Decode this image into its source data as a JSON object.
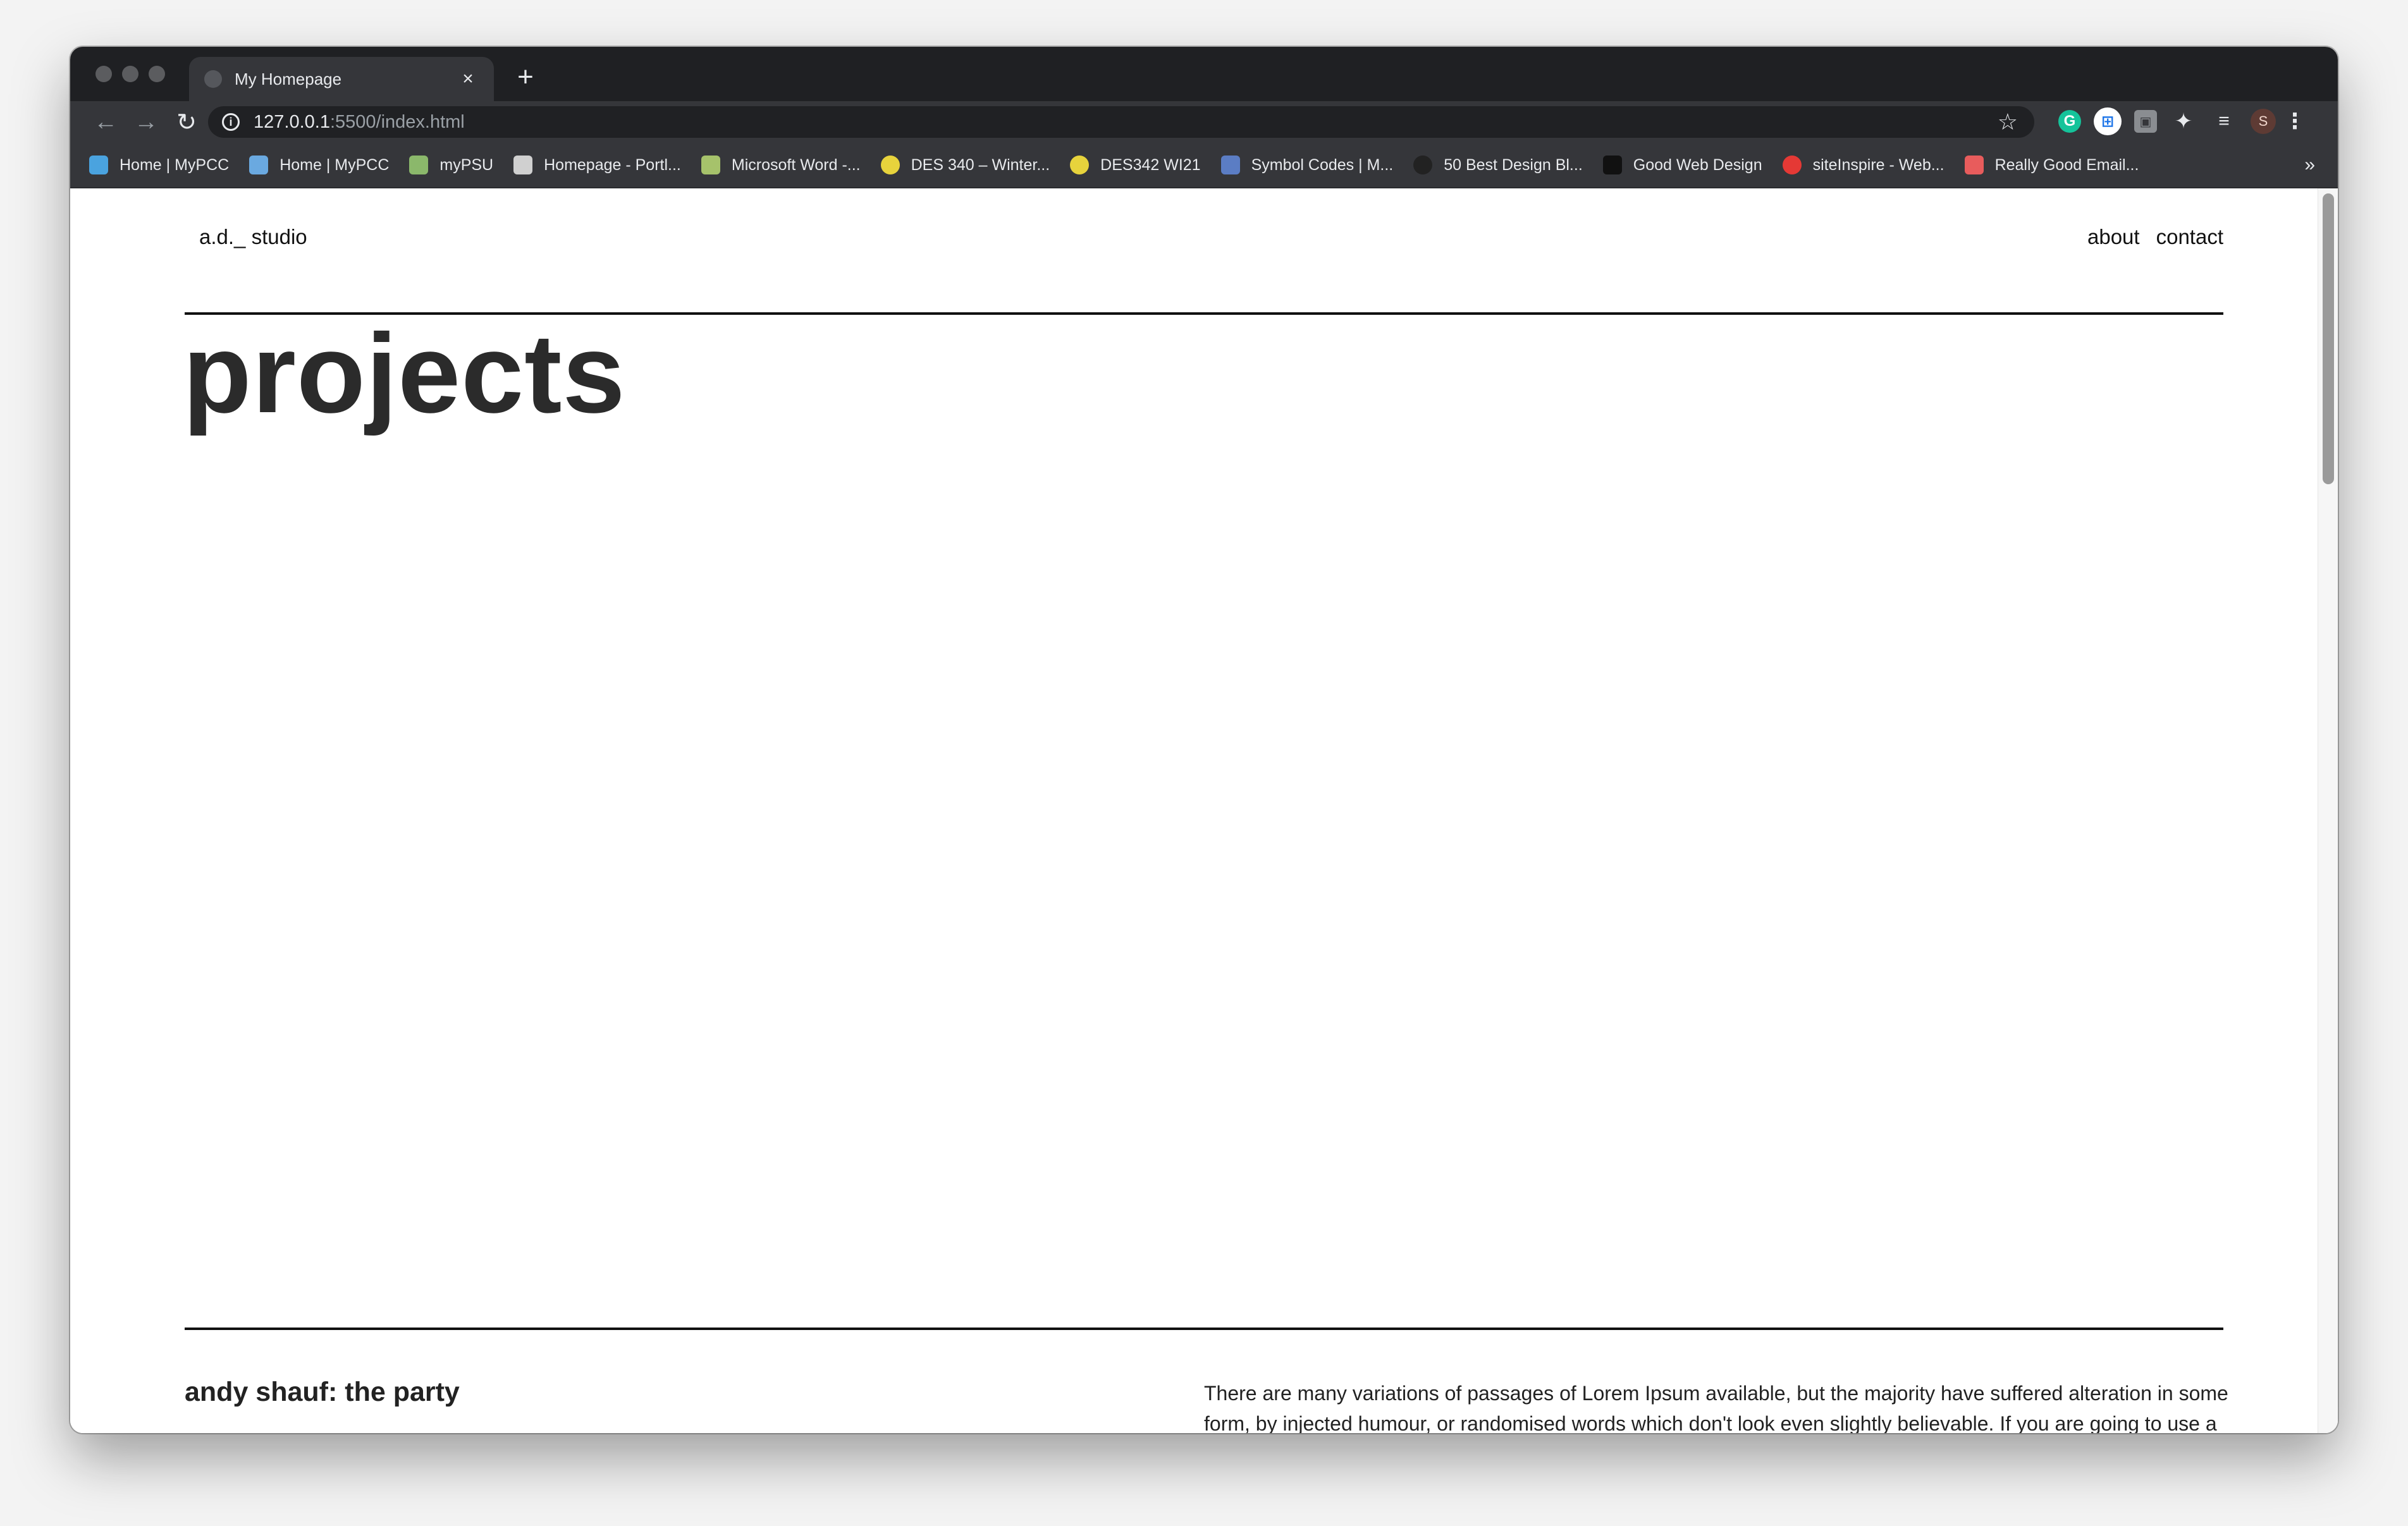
{
  "browser": {
    "tab": {
      "title": "My Homepage",
      "close": "×",
      "new_tab": "+"
    },
    "toolbar": {
      "back": "←",
      "forward": "→",
      "reload": "↻",
      "url_host": "127.0.0.1",
      "url_path": ":5500/index.html",
      "info": "i",
      "star": "☆"
    },
    "extensions": {
      "grammarly": "G",
      "grid": "⊞",
      "square": "▣",
      "puzzle": "✦",
      "queue": "≡",
      "avatar": "S",
      "menu": "⋮"
    },
    "bookmarks": [
      {
        "label": "Home | MyPCC",
        "icon_color": "#4aa3df"
      },
      {
        "label": "Home | MyPCC",
        "icon_color": "#6aa9e0"
      },
      {
        "label": "myPSU",
        "icon_color": "#8bb86b"
      },
      {
        "label": "Homepage - Portl...",
        "icon_color": "#d0d0d0"
      },
      {
        "label": "Microsoft Word -...",
        "icon_color": "#a6c26b"
      },
      {
        "label": "DES 340 – Winter...",
        "icon_color": "#e7d33c"
      },
      {
        "label": "DES342 WI21",
        "icon_color": "#e7d33c"
      },
      {
        "label": "Symbol Codes | M...",
        "icon_color": "#5b7dc4"
      },
      {
        "label": "50 Best Design Bl...",
        "icon_color": "#222222"
      },
      {
        "label": "Good Web Design",
        "icon_color": "#111111"
      },
      {
        "label": "siteInspire - Web...",
        "icon_color": "#e53935"
      },
      {
        "label": "Really Good Email...",
        "icon_color": "#e85c5c"
      }
    ],
    "bookmarks_more": "»"
  },
  "site": {
    "logo": "a.d._ studio",
    "nav": {
      "about": "about",
      "contact": "contact"
    },
    "title": "projects",
    "project": {
      "title": "andy shauf: the party",
      "description": "There are many variations of passages of Lorem Ipsum available, but the majority have suffered alteration in some form, by injected humour, or randomised words which don't look even slightly believable. If you are going to use a passage of Lorem Ipsum, you need to be sure there isn't anything embarrassing hidden in the middle of"
    }
  }
}
